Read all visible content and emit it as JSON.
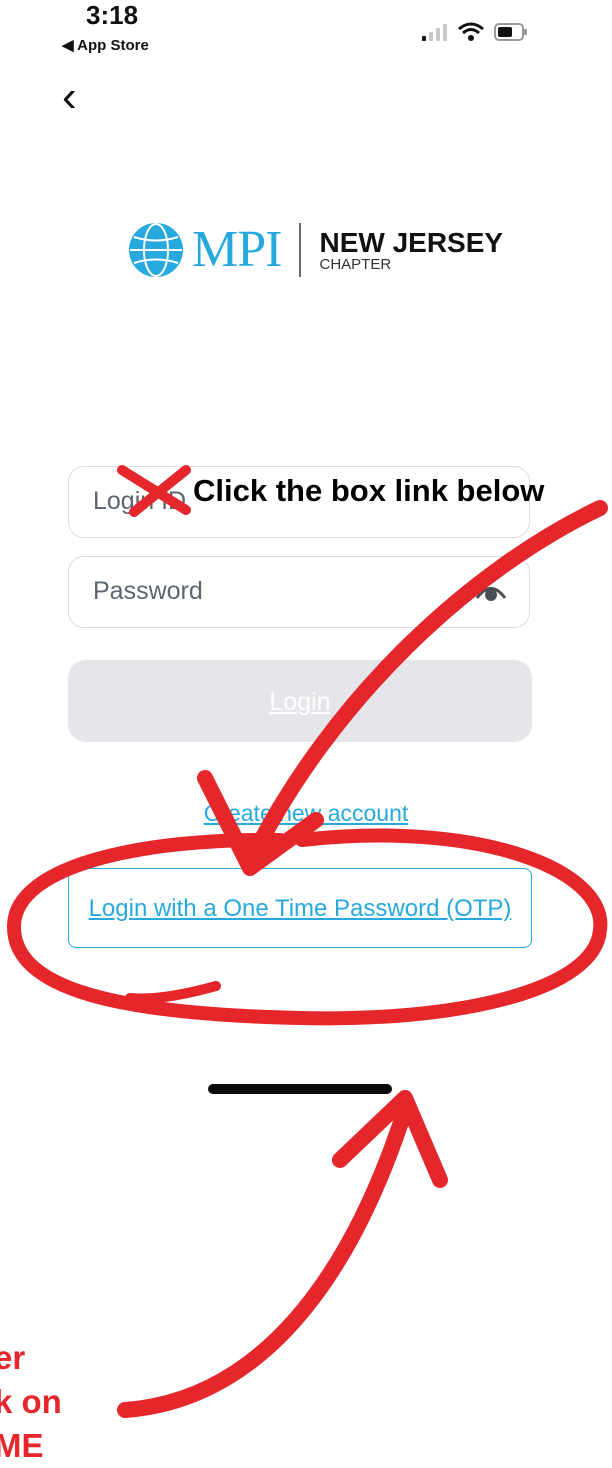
{
  "status_bar": {
    "time": "3:18",
    "back_app": "◀ App Store"
  },
  "nav": {
    "back_icon": "‹"
  },
  "logo": {
    "mpi": "MPI",
    "name": "NEW JERSEY",
    "sub": "CHAPTER"
  },
  "form": {
    "login_id_placeholder": "Login ID",
    "password_placeholder": "Password",
    "login_button": "Login",
    "create_account": "Create new account",
    "otp_button": "Login with a One Time Password (OTP)"
  },
  "annotations": {
    "top_note": "Click the box link below",
    "bottom_note_line1": "er",
    "bottom_note_line2": "k on",
    "bottom_note_line3": "ME"
  },
  "colors": {
    "accent": "#27a9dd",
    "annotation_red": "#e5262b"
  }
}
